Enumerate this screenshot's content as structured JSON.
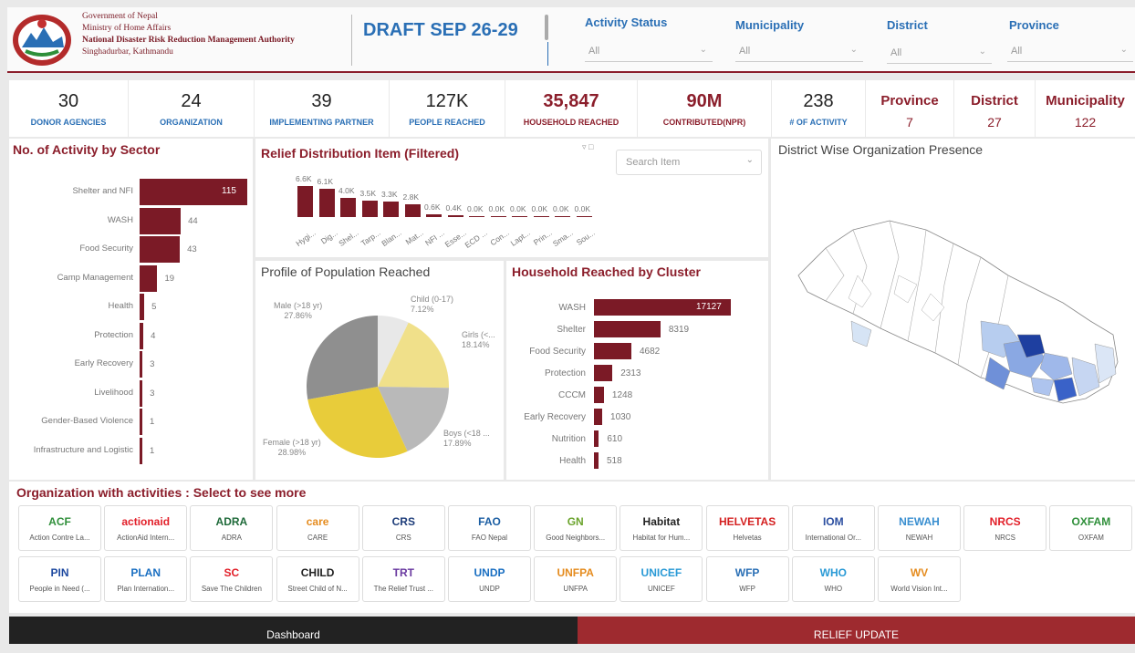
{
  "header": {
    "govt_lines": [
      "Government of Nepal",
      "Ministry of Home Affairs",
      "National Disaster Risk Reduction Management Authority",
      "Singhadurbar, Kathmandu"
    ],
    "draft_title": "DRAFT SEP 26-29",
    "filters": [
      {
        "label": "Activity Status",
        "value": "All"
      },
      {
        "label": "Municipality",
        "value": "All"
      },
      {
        "label": "District",
        "value": "All"
      },
      {
        "label": "Province",
        "value": "All"
      }
    ]
  },
  "kpis": [
    {
      "value": "30",
      "label": "DONOR AGENCIES"
    },
    {
      "value": "24",
      "label": "ORGANIZATION"
    },
    {
      "value": "39",
      "label": "IMPLEMENTING PARTNER"
    },
    {
      "value": "127K",
      "label": "PEOPLE REACHED"
    },
    {
      "value": "35,847",
      "label": "HOUSEHOLD REACHED"
    },
    {
      "value": "90M",
      "label": "CONTRIBUTED(NPR)"
    },
    {
      "value": "238",
      "label": "# OF ACTIVITY"
    },
    {
      "value": "Province",
      "label": "7"
    },
    {
      "value": "District",
      "label": "27"
    },
    {
      "value": "Municipality",
      "label": "122"
    }
  ],
  "sector_chart": {
    "title": "No. of Activity by Sector",
    "items": [
      {
        "label": "Shelter and NFI",
        "value": 115
      },
      {
        "label": "WASH",
        "value": 44
      },
      {
        "label": "Food Security",
        "value": 43
      },
      {
        "label": "Camp Management",
        "value": 19
      },
      {
        "label": "Health",
        "value": 5
      },
      {
        "label": "Protection",
        "value": 4
      },
      {
        "label": "Early Recovery",
        "value": 3
      },
      {
        "label": "Livelihood",
        "value": 3
      },
      {
        "label": "Gender-Based Violence",
        "value": 1
      },
      {
        "label": "Infrastructure and Logistic",
        "value": 1
      }
    ]
  },
  "relief_chart": {
    "title": "Relief Distribution Item (Filtered)",
    "search_placeholder": "Search Item",
    "items": [
      {
        "label": "Hygi...",
        "value": 6.6,
        "text": "6.6K"
      },
      {
        "label": "Dig...",
        "value": 6.1,
        "text": "6.1K"
      },
      {
        "label": "Shel...",
        "value": 4.0,
        "text": "4.0K"
      },
      {
        "label": "Tarp...",
        "value": 3.5,
        "text": "3.5K"
      },
      {
        "label": "Blan...",
        "value": 3.3,
        "text": "3.3K"
      },
      {
        "label": "Mat...",
        "value": 2.8,
        "text": "2.8K"
      },
      {
        "label": "NFI ...",
        "value": 0.6,
        "text": "0.6K"
      },
      {
        "label": "Esse...",
        "value": 0.4,
        "text": "0.4K"
      },
      {
        "label": "ECD ...",
        "value": 0.0,
        "text": "0.0K"
      },
      {
        "label": "Con...",
        "value": 0.0,
        "text": "0.0K"
      },
      {
        "label": "Lapt...",
        "value": 0.0,
        "text": "0.0K"
      },
      {
        "label": "Prin...",
        "value": 0.0,
        "text": "0.0K"
      },
      {
        "label": "Sma...",
        "value": 0.0,
        "text": "0.0K"
      },
      {
        "label": "Sou...",
        "value": 0.0,
        "text": "0.0K"
      }
    ]
  },
  "profile_chart": {
    "title": "Profile of Population Reached",
    "slices": [
      {
        "label": "Child (0-17)",
        "pct": "7.12%",
        "value": 7.12,
        "color": "#e8e8e8"
      },
      {
        "label": "Girls (<...",
        "pct": "18.14%",
        "value": 18.14,
        "color": "#f0e08a"
      },
      {
        "label": "Boys (<18 ...",
        "pct": "17.89%",
        "value": 17.89,
        "color": "#b9b9b9"
      },
      {
        "label": "Female (>18 yr)",
        "pct": "28.98%",
        "value": 28.98,
        "color": "#e8cc3a"
      },
      {
        "label": "Male (>18 yr)",
        "pct": "27.86%",
        "value": 27.86,
        "color": "#8f8f8f"
      }
    ]
  },
  "cluster_chart": {
    "title": "Household Reached by Cluster",
    "items": [
      {
        "label": "WASH",
        "value": 17127
      },
      {
        "label": "Shelter",
        "value": 8319
      },
      {
        "label": "Food Security",
        "value": 4682
      },
      {
        "label": "Protection",
        "value": 2313
      },
      {
        "label": "CCCM",
        "value": 1248
      },
      {
        "label": "Early Recovery",
        "value": 1030
      },
      {
        "label": "Nutrition",
        "value": 610
      },
      {
        "label": "Health",
        "value": 518
      }
    ]
  },
  "map": {
    "title": "District Wise Organization Presence"
  },
  "orgs": {
    "title": "Organization with activities : Select to see more",
    "row1": [
      {
        "logo": "ACF",
        "name": "Action Contre La...",
        "color": "#2f8f3a"
      },
      {
        "logo": "actionaid",
        "name": "ActionAid Intern...",
        "color": "#e2202a"
      },
      {
        "logo": "ADRA",
        "name": "ADRA",
        "color": "#1f6a3a"
      },
      {
        "logo": "care",
        "name": "CARE",
        "color": "#e58c1f"
      },
      {
        "logo": "CRS",
        "name": "CRS",
        "color": "#1e3d7a"
      },
      {
        "logo": "FAO",
        "name": "FAO Nepal",
        "color": "#1b5ea3"
      },
      {
        "logo": "GN",
        "name": "Good Neighbors...",
        "color": "#6aa32b"
      },
      {
        "logo": "Habitat",
        "name": "Habitat for Hum...",
        "color": "#222222"
      },
      {
        "logo": "HELVETAS",
        "name": "Helvetas",
        "color": "#d42020"
      },
      {
        "logo": "IOM",
        "name": "International Or...",
        "color": "#2b4ea0"
      },
      {
        "logo": "NEWAH",
        "name": "NEWAH",
        "color": "#3a8fd0"
      },
      {
        "logo": "NRCS",
        "name": "NRCS",
        "color": "#e2202a"
      },
      {
        "logo": "OXFAM",
        "name": "OXFAM",
        "color": "#2f8f3a"
      }
    ],
    "row2": [
      {
        "logo": "PIN",
        "name": "People in Need (...",
        "color": "#1f4aa0"
      },
      {
        "logo": "PLAN",
        "name": "Plan Internation...",
        "color": "#1a6fc2"
      },
      {
        "logo": "SC",
        "name": "Save The Children",
        "color": "#e2202a"
      },
      {
        "logo": "CHILD",
        "name": "Street Child of N...",
        "color": "#222222"
      },
      {
        "logo": "TRT",
        "name": "The Relief Trust ...",
        "color": "#6a3aa0"
      },
      {
        "logo": "UNDP",
        "name": "UNDP",
        "color": "#1a6fc2"
      },
      {
        "logo": "UNFPA",
        "name": "UNFPA",
        "color": "#e58c1f"
      },
      {
        "logo": "UNICEF",
        "name": "UNICEF",
        "color": "#2a9ad6"
      },
      {
        "logo": "WFP",
        "name": "WFP",
        "color": "#2a6fb5"
      },
      {
        "logo": "WHO",
        "name": "WHO",
        "color": "#2a9ad6"
      },
      {
        "logo": "WV",
        "name": "World Vision Int...",
        "color": "#e58c1f"
      }
    ]
  },
  "footer": {
    "left": "Dashboard",
    "right": "RELIEF UPDATE"
  },
  "colors": {
    "accent": "#7b1a26",
    "blue": "#2a6fb5"
  }
}
